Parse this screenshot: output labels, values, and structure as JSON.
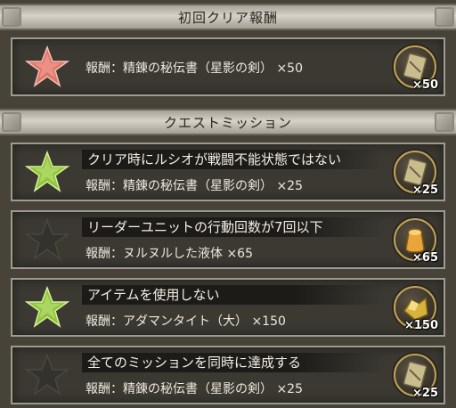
{
  "first_clear": {
    "header": "初回クリア報酬",
    "reward": "報酬：精錬の秘伝書（星影の剣） ×50",
    "item_icon": "book-icon",
    "qty": "×50",
    "star_color": "#e0756a"
  },
  "quest_missions": {
    "header": "クエストミッション",
    "missions": [
      {
        "text": "クリア時にルシオが戦闘不能状態ではない",
        "reward": "報酬：精錬の秘伝書（星影の剣） ×25",
        "item_icon": "book-icon",
        "qty": "×25",
        "achieved": true
      },
      {
        "text": "リーダーユニットの行動回数が7回以下",
        "reward": "報酬：ヌルヌルした液体 ×65",
        "item_icon": "potion-icon",
        "qty": "×65",
        "achieved": false
      },
      {
        "text": "アイテムを使用しない",
        "reward": "報酬：アダマンタイト（大） ×150",
        "item_icon": "ore-icon",
        "qty": "×150",
        "achieved": true
      },
      {
        "text": "全てのミッションを同時に達成する",
        "reward": "報酬：精錬の秘伝書（星影の剣） ×25",
        "item_icon": "book-icon",
        "qty": "×25",
        "achieved": false
      }
    ]
  },
  "colors": {
    "achieved_star": "#8fc43c",
    "unachieved_star": "#34322c",
    "first_clear_star": "#e0756a"
  }
}
